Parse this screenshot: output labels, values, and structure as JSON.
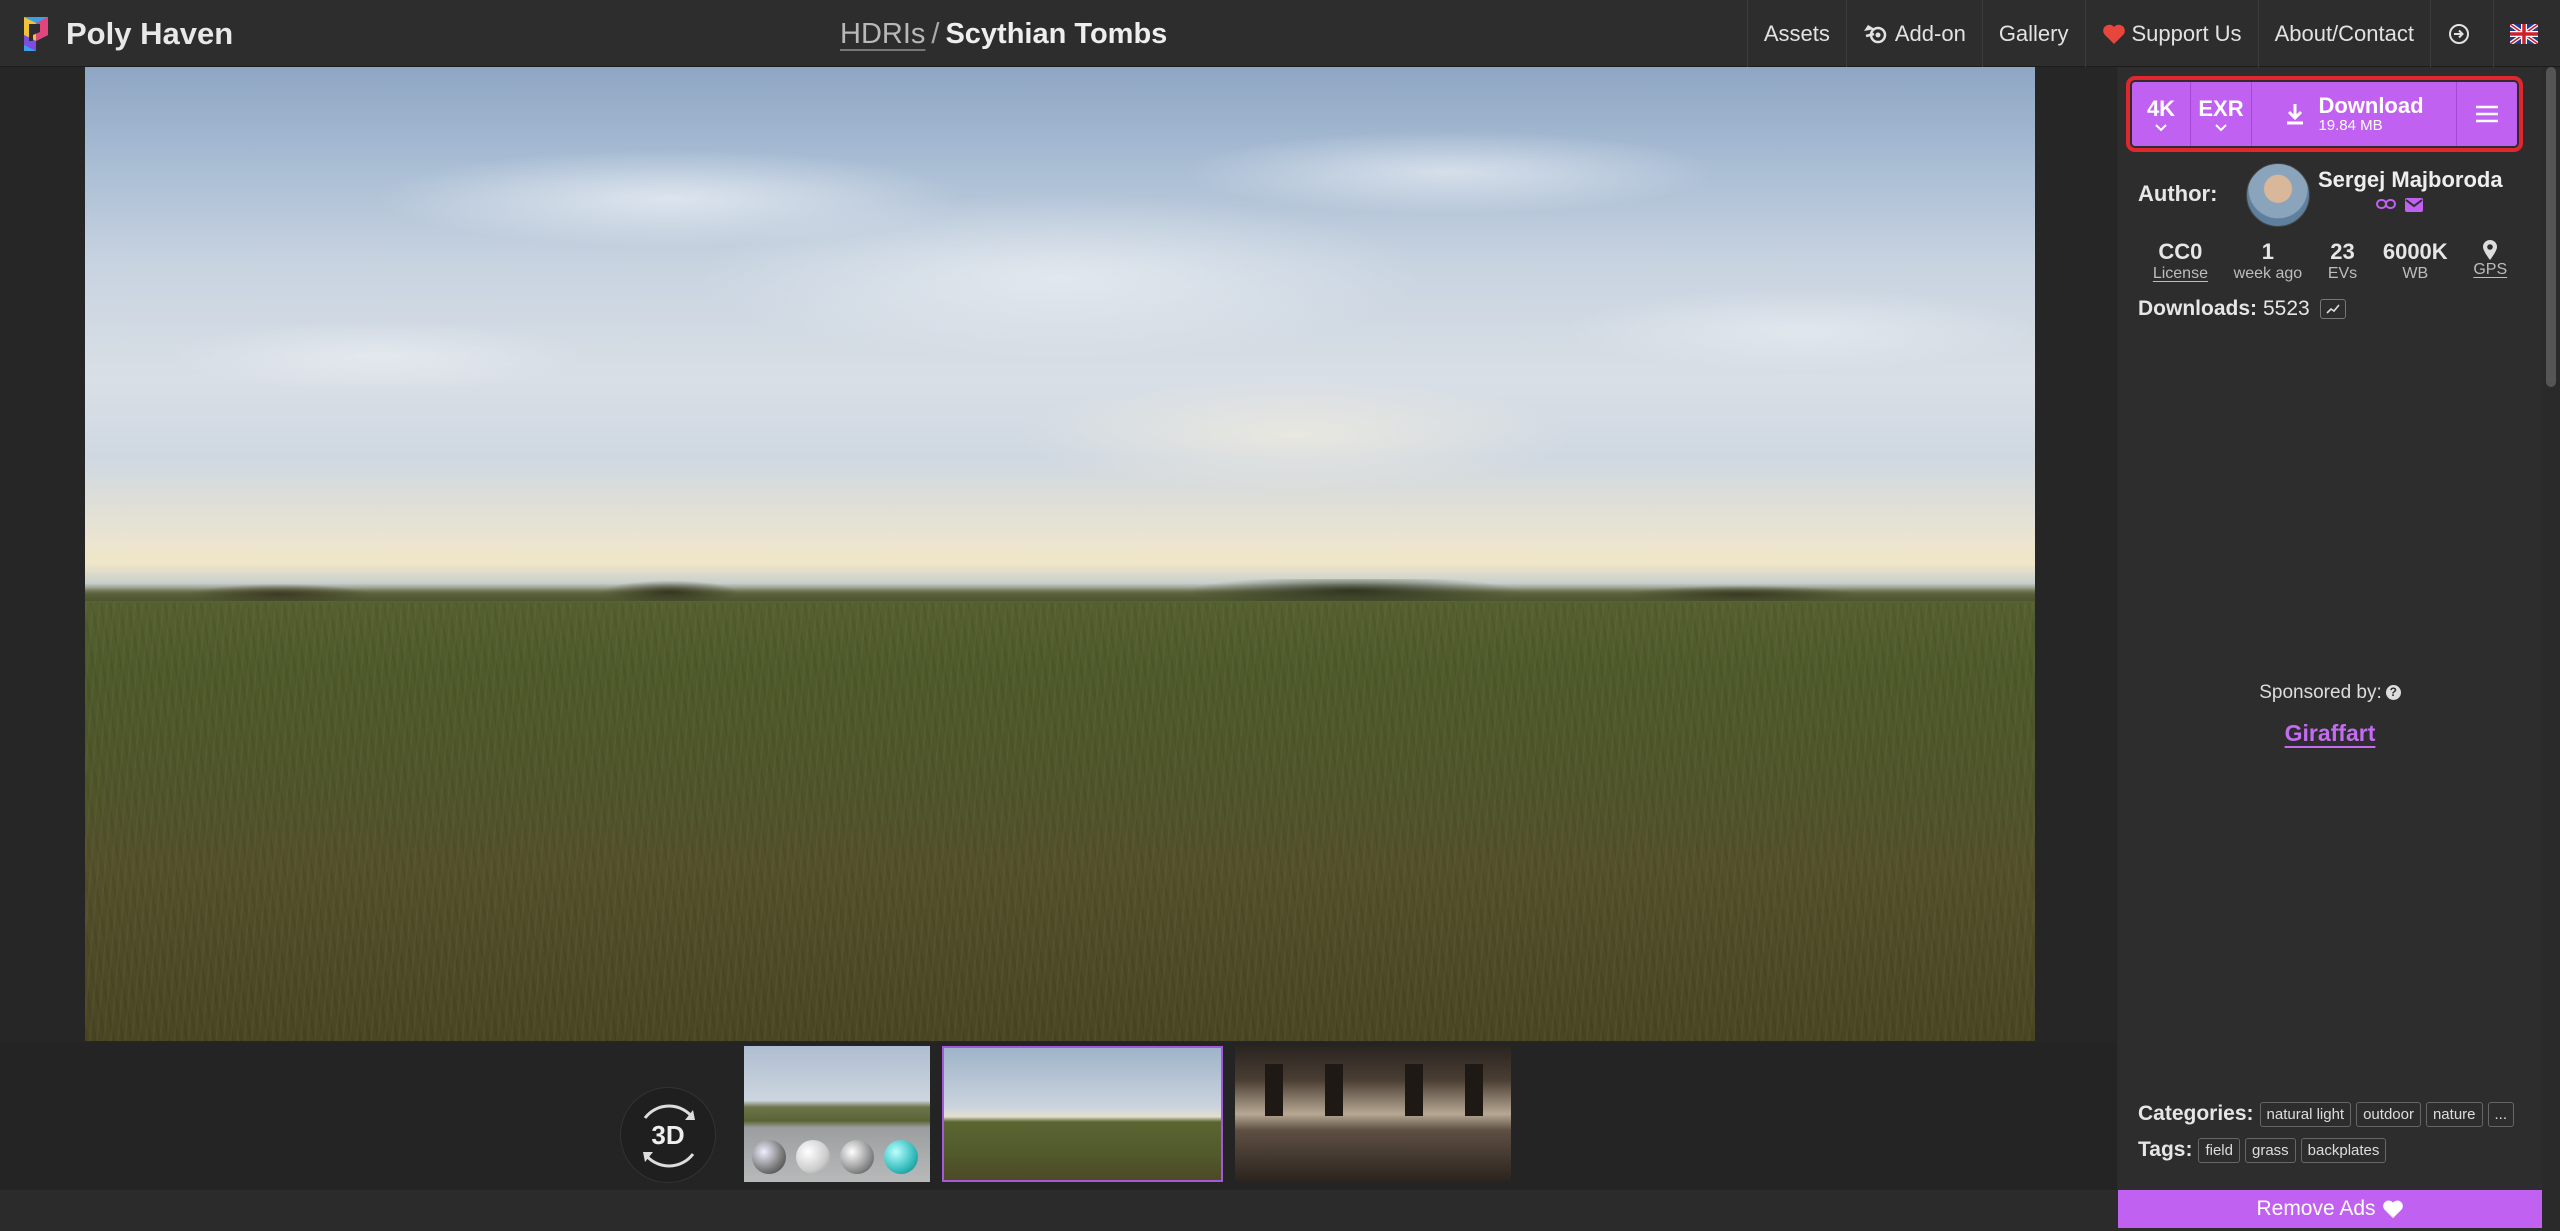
{
  "header": {
    "brand": "Poly Haven",
    "breadcrumb": {
      "section": "HDRIs",
      "separator": "/",
      "title": "Scythian Tombs"
    },
    "nav": [
      {
        "label": "Assets",
        "icon": ""
      },
      {
        "label": "Add-on",
        "icon": "blender-icon"
      },
      {
        "label": "Gallery",
        "icon": ""
      },
      {
        "label": "Support Us",
        "icon": "heart-icon"
      },
      {
        "label": "About/Contact",
        "icon": ""
      }
    ],
    "login_icon": "login-icon",
    "language_icon": "uk-flag-icon"
  },
  "viewer": {
    "viewer_3d_label": "3D",
    "thumbnails": [
      "thumbnail-spheres",
      "thumbnail-panorama",
      "thumbnail-related"
    ],
    "selected_thumbnail": 1
  },
  "download": {
    "resolution": "4K",
    "format": "EXR",
    "label": "Download",
    "size": "19.84 MB"
  },
  "author": {
    "label": "Author:",
    "name": "Sergej Majboroda"
  },
  "stats": [
    {
      "value": "CC0",
      "label": "License"
    },
    {
      "value": "1",
      "label": "week ago"
    },
    {
      "value": "23",
      "label": "EVs"
    },
    {
      "value": "6000K",
      "label": "WB"
    },
    {
      "value": "",
      "label": "GPS"
    }
  ],
  "downloads": {
    "label": "Downloads:",
    "count": "5523"
  },
  "sponsor": {
    "label": "Sponsored by:",
    "name": "Giraffart"
  },
  "categories": {
    "label": "Categories:",
    "items": [
      "natural light",
      "outdoor",
      "nature"
    ],
    "more": "..."
  },
  "tags": {
    "label": "Tags:",
    "items": [
      "field",
      "grass",
      "backplates"
    ]
  },
  "remove_ads": "Remove Ads",
  "colors": {
    "accent": "#c161f2",
    "highlight": "#e0262f",
    "background": "#2b2b2b"
  }
}
